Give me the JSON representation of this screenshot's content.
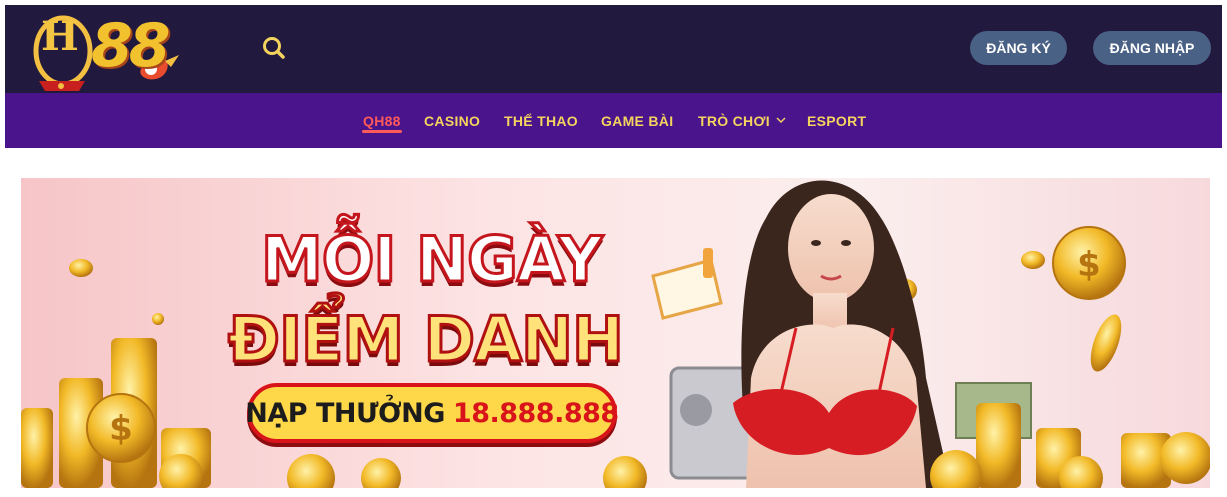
{
  "header": {
    "logo_text_prefix": "H",
    "logo_text_number": "88",
    "search_icon": "search-icon",
    "register_label": "ĐĂNG KÝ",
    "login_label": "ĐĂNG NHẬP"
  },
  "nav": {
    "items": [
      {
        "label": "QH88",
        "active": true
      },
      {
        "label": "CASINO"
      },
      {
        "label": "THỂ THAO"
      },
      {
        "label": "GAME BÀI"
      },
      {
        "label": "TRÒ CHƠI",
        "has_dropdown": true
      },
      {
        "label": "ESPORT"
      }
    ]
  },
  "banner": {
    "line1": "MỖI NGÀY",
    "line2": "ĐIỂM DANH",
    "pill_text": "NẠP THƯỞNG",
    "pill_amount": "18.888.888"
  },
  "colors": {
    "topbar": "#221a3e",
    "navbar": "#4a148c",
    "nav_text": "#f4d35e",
    "nav_active": "#ff5a5a",
    "button": "#4a6186"
  }
}
